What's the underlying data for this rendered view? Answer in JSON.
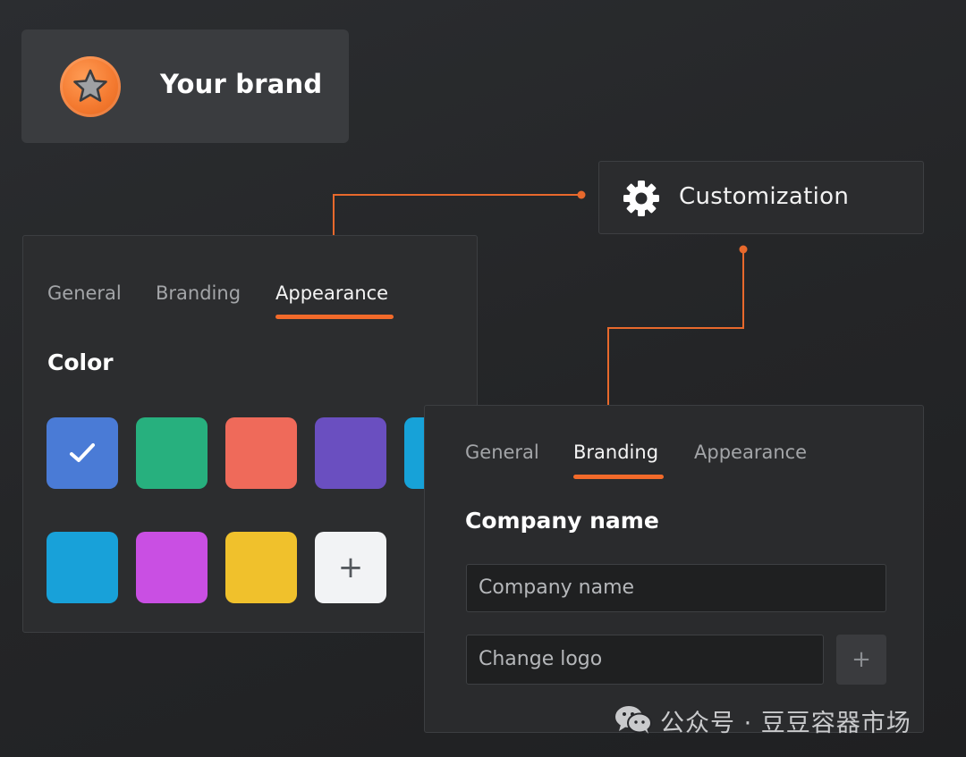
{
  "brand": {
    "name": "Your brand",
    "logo_icon": "star-icon",
    "logo_color": "#f47a30"
  },
  "customization": {
    "title": "Customization",
    "icon": "gear-icon"
  },
  "appearance_panel": {
    "tabs": [
      {
        "label": "General",
        "active": false
      },
      {
        "label": "Branding",
        "active": false
      },
      {
        "label": "Appearance",
        "active": true
      }
    ],
    "section_title": "Color",
    "swatches": [
      {
        "color": "#4a7bd6",
        "selected": true
      },
      {
        "color": "#27b07e",
        "selected": false
      },
      {
        "color": "#ef6a5a",
        "selected": false
      },
      {
        "color": "#6a4fc0",
        "selected": false
      },
      {
        "color": "#17a2d8",
        "selected": false
      },
      {
        "color": "#18a1d9",
        "selected": false
      },
      {
        "color": "#c94fe3",
        "selected": false
      },
      {
        "color": "#f0c12c",
        "selected": false
      }
    ],
    "add_swatch_label": "+"
  },
  "branding_panel": {
    "tabs": [
      {
        "label": "General",
        "active": false
      },
      {
        "label": "Branding",
        "active": true
      },
      {
        "label": "Appearance",
        "active": false
      }
    ],
    "section_title": "Company name",
    "company_name_placeholder": "Company name",
    "change_logo_placeholder": "Change logo",
    "add_logo_label": "+"
  },
  "accent_color": "#f26a2a",
  "watermark": {
    "text": "公众号 · 豆豆容器市场",
    "icon": "wechat-icon"
  }
}
